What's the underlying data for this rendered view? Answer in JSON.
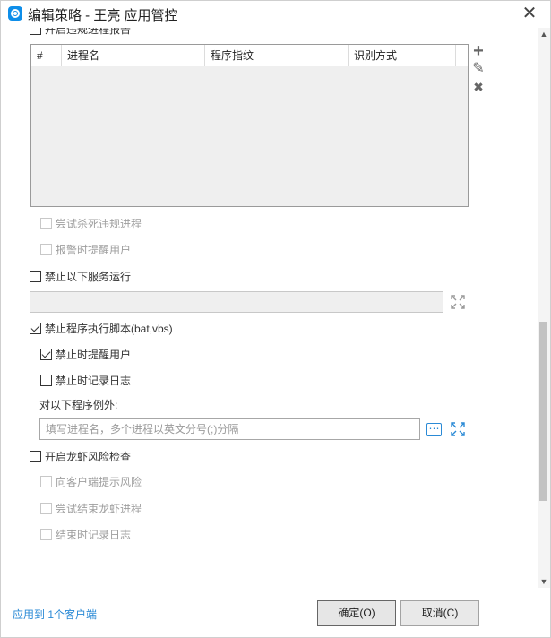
{
  "window": {
    "title": "编辑策略 - 王亮 应用管控",
    "close_glyph": "✕",
    "app_icon": "teamviewer-logo-icon"
  },
  "sections": {
    "illegal_process_report": {
      "label": "开启违规进程报告",
      "checked": false
    },
    "process_table": {
      "columns": [
        "#",
        "进程名",
        "程序指纹",
        "识别方式"
      ],
      "rows": []
    },
    "side_actions": {
      "add": "+",
      "edit": "✎",
      "delete": "✖"
    },
    "try_kill": {
      "label": "尝试杀死违规进程",
      "checked": false,
      "disabled": true
    },
    "alarm_notify": {
      "label": "报警时提醒用户",
      "checked": false,
      "disabled": true
    },
    "forbid_services": {
      "label": "禁止以下服务运行",
      "checked": false
    },
    "forbid_scripts": {
      "label": "禁止程序执行脚本(bat,vbs)",
      "checked": true
    },
    "forbid_notify": {
      "label": "禁止时提醒用户",
      "checked": true
    },
    "forbid_log": {
      "label": "禁止时记录日志",
      "checked": false
    },
    "exceptions": {
      "label": "对以下程序例外:",
      "placeholder": "填写进程名，多个进程以英文分号(;)分隔",
      "more_glyph": "⋯"
    },
    "longxia_check": {
      "label": "开启龙虾风险检查",
      "checked": false
    },
    "client_warn": {
      "label": "向客户端提示风险",
      "checked": false,
      "disabled": true
    },
    "try_end_longxia": {
      "label": "尝试结束龙虾进程",
      "checked": false,
      "disabled": true
    },
    "end_log": {
      "label": "结束时记录日志",
      "checked": false,
      "disabled": true
    }
  },
  "scrollbar": {
    "up": "▲",
    "down": "▼"
  },
  "footer": {
    "apply_link": "应用到 1个客户端",
    "ok_label": "确定(O)",
    "cancel_label": "取消(C)"
  },
  "colors": {
    "accent": "#2a8ad6",
    "disabled_fill": "#efefef"
  }
}
